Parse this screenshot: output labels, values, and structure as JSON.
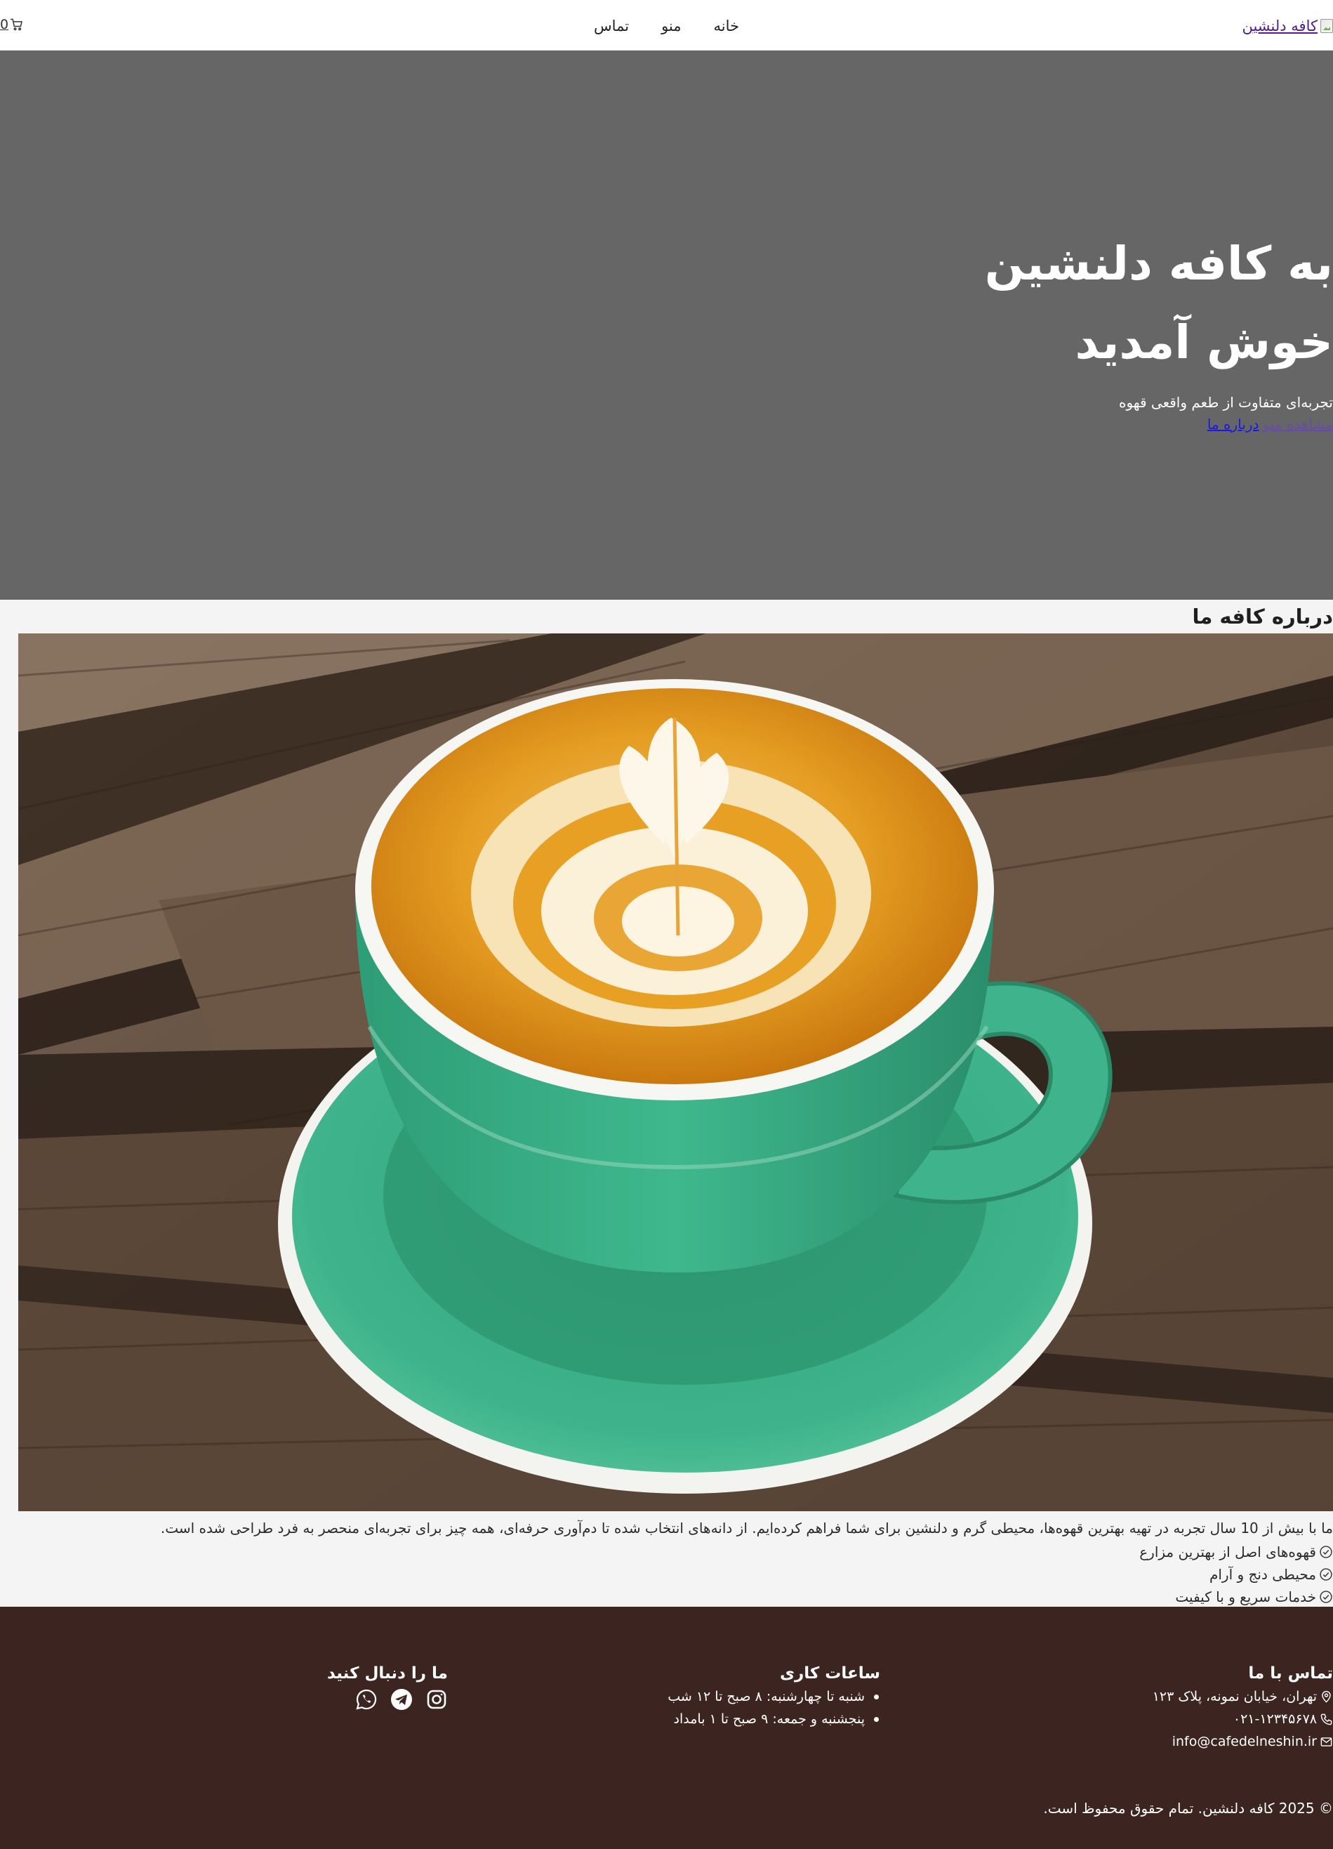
{
  "header": {
    "logo_alt": "کافه دلنشین",
    "nav": [
      {
        "label": "خانه"
      },
      {
        "label": "منو"
      },
      {
        "label": "تماس"
      }
    ],
    "cart_count": "0"
  },
  "hero": {
    "title": "به کافه دلنشین خوش آمدید",
    "subtitle": "تجربه‌ای متفاوت از طعم واقعی قهوه",
    "links": {
      "menu": "مشاهده منو",
      "about": "درباره ما"
    }
  },
  "about": {
    "title": "درباره کافه ما",
    "text": "ما با بیش از 10 سال تجربه در تهیه بهترین قهوه‌ها، محیطی گرم و دلنشین برای شما فراهم کرده‌ایم. از دانه‌های انتخاب شده تا دم‌آوری حرفه‌ای، همه چیز برای تجربه‌ای منحصر به فرد طراحی شده است.",
    "features": [
      "قهوه‌های اصل از بهترین مزارع",
      "محیطی دنج و آرام",
      "خدمات سریع و با کیفیت"
    ]
  },
  "footer": {
    "contact": {
      "title": "تماس با ما",
      "address": "تهران، خیابان نمونه، پلاک ۱۲۳",
      "phone": "۰۲۱-۱۲۳۴۵۶۷۸",
      "email": "info@cafedelneshin.ir"
    },
    "hours": {
      "title": "ساعات کاری",
      "items": [
        "شنبه تا چهارشنبه: ۸ صبح تا ۱۲ شب",
        "پنجشنبه و جمعه: ۹ صبح تا ۱ بامداد"
      ]
    },
    "social": {
      "title": "ما را دنبال کنید",
      "icons": [
        "instagram-icon",
        "telegram-icon",
        "whatsapp-icon"
      ]
    },
    "copyright": "© 2025 کافه دلنشین. تمام حقوق محفوظ است."
  },
  "colors": {
    "hero_bg": "#666666",
    "footer_bg": "#3c2421",
    "page_bg": "#f4f4f4",
    "cup_green": "#3fae86",
    "crema": "#e49a1c"
  }
}
